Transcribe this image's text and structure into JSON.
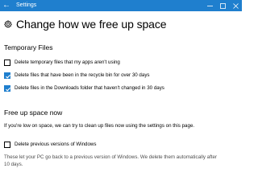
{
  "window": {
    "title": "Settings",
    "accent_color": "#1f7fce",
    "controls": [
      "minimize-icon",
      "maximize-icon",
      "close-icon"
    ]
  },
  "page": {
    "title": "Change how we free up space",
    "icon": "gear-icon"
  },
  "temporary_files": {
    "heading": "Temporary Files",
    "options": [
      {
        "label": "Delete temporary files that my apps aren't using",
        "checked": false
      },
      {
        "label": "Delete files that have been in the recycle bin for over 30 days",
        "checked": true
      },
      {
        "label": "Delete files in the Downloads folder that haven't changed in 30 days",
        "checked": true
      }
    ]
  },
  "free_up_space": {
    "heading": "Free up space now",
    "description": "If you're low on space, we can try to clean up files now using the settings on this page.",
    "option": {
      "label": "Delete previous versions of Windows",
      "checked": false
    },
    "note": "These let your PC go back to a previous version of Windows. We delete them automatically after 10 days."
  }
}
